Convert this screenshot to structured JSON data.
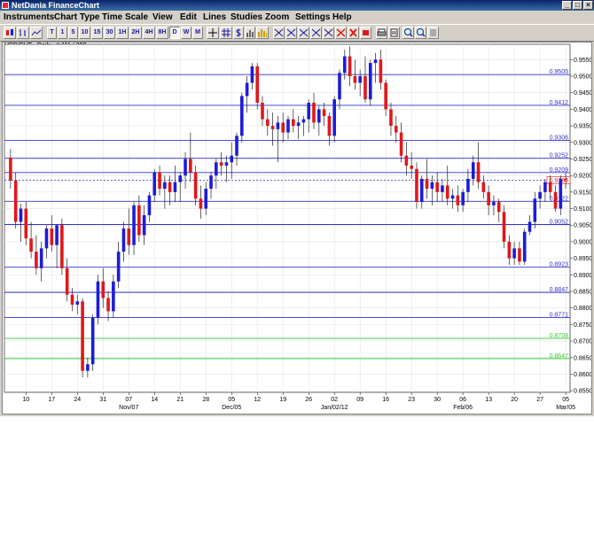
{
  "window": {
    "title": "NetDania FinanceChart",
    "minimize": "_",
    "maximize": "□",
    "close": "×"
  },
  "menu": [
    "Instruments",
    "Chart Type",
    "Time Scale",
    "View",
    "Edit",
    "Lines",
    "Studies",
    "Zoom",
    "Settings",
    "Help"
  ],
  "toolbar": {
    "timeframes": [
      "T",
      "1",
      "5",
      "10",
      "15",
      "30",
      "1H",
      "2H",
      "4H",
      "8H",
      "D",
      "W",
      "M"
    ],
    "selected_timeframe": "D",
    "tool_icons": [
      "candle-icon",
      "bars-icon",
      "line-chart-icon",
      "crosshair-icon",
      "grid-icon",
      "dollar-icon",
      "volume-icon",
      "trendline-icon",
      "channel-icon",
      "fibonacci-icon",
      "fan-icon",
      "arc-icon",
      "delete-line-icon",
      "delete-all-icon",
      "eraser-icon",
      "print-icon",
      "save-icon",
      "zoom-in-icon",
      "zoom-out-icon",
      "reset-icon"
    ]
  },
  "chart_data": {
    "type": "candlestick",
    "instrument_label": "USD/CHF , Daily , # 111 / 300",
    "current_price_label": "0.9186",
    "y_range": [
      0.855,
      0.96
    ],
    "y_ticks": [
      "0.9550",
      "0.9500",
      "0.9450",
      "0.9400",
      "0.9350",
      "0.9300",
      "0.9250",
      "0.9200",
      "0.9150",
      "0.9100",
      "0.9050",
      "0.9000",
      "0.8950",
      "0.8900",
      "0.8850",
      "0.8800",
      "0.8750",
      "0.8700",
      "0.8650",
      "0.8600",
      "0.8550"
    ],
    "x_ticks": [
      "10",
      "17",
      "24",
      "31",
      "07",
      "14",
      "21",
      "28",
      "05",
      "12",
      "19",
      "26",
      "02",
      "09",
      "16",
      "23",
      "30",
      "06",
      "13",
      "20",
      "27",
      "05"
    ],
    "x_month_labels": [
      {
        "label": "Nov/07",
        "index": 4
      },
      {
        "label": "Dec/05",
        "index": 8
      },
      {
        "label": "Jan/02/12",
        "index": 12
      },
      {
        "label": "Feb/06",
        "index": 17
      },
      {
        "label": "Mar/05",
        "index": 21
      }
    ],
    "horizontal_lines": [
      {
        "value": 0.9505,
        "label": "0.9505",
        "color": "#3333cc"
      },
      {
        "value": 0.9412,
        "label": "0.9412",
        "color": "#3333cc"
      },
      {
        "value": 0.9306,
        "label": "0.9306",
        "color": "#3333cc"
      },
      {
        "value": 0.9252,
        "label": "0.9252",
        "color": "#3333cc"
      },
      {
        "value": 0.9209,
        "label": "0.9209",
        "color": "#3333cc"
      },
      {
        "value": 0.9122,
        "label": "0.9122",
        "color": "#3333cc"
      },
      {
        "value": 0.9052,
        "label": "0.9052",
        "color": "#3333cc"
      },
      {
        "value": 0.8923,
        "label": "0.8923",
        "color": "#3333cc"
      },
      {
        "value": 0.8847,
        "label": "0.8847",
        "color": "#3333cc"
      },
      {
        "value": 0.8771,
        "label": "0.8771",
        "color": "#3333cc"
      },
      {
        "value": 0.8708,
        "label": "0.8708",
        "color": "#33cc33"
      },
      {
        "value": 0.8647,
        "label": "0.8647",
        "color": "#33cc33"
      }
    ],
    "current_price": 0.9186,
    "up_color": "#1c1cd8",
    "down_color": "#e01818",
    "grid": true,
    "candles": [
      [
        0.9254,
        0.928,
        0.916,
        0.9185
      ],
      [
        0.9185,
        0.921,
        0.904,
        0.906
      ],
      [
        0.906,
        0.9115,
        0.9,
        0.91
      ],
      [
        0.91,
        0.912,
        0.899,
        0.901
      ],
      [
        0.901,
        0.906,
        0.895,
        0.897
      ],
      [
        0.897,
        0.902,
        0.89,
        0.892
      ],
      [
        0.892,
        0.9,
        0.888,
        0.898
      ],
      [
        0.898,
        0.905,
        0.895,
        0.904
      ],
      [
        0.904,
        0.908,
        0.897,
        0.899
      ],
      [
        0.899,
        0.903,
        0.892,
        0.905
      ],
      [
        0.905,
        0.907,
        0.89,
        0.892
      ],
      [
        0.892,
        0.895,
        0.882,
        0.884
      ],
      [
        0.884,
        0.886,
        0.879,
        0.881
      ],
      [
        0.881,
        0.884,
        0.878,
        0.882
      ],
      [
        0.882,
        0.883,
        0.859,
        0.861
      ],
      [
        0.861,
        0.865,
        0.859,
        0.863
      ],
      [
        0.863,
        0.878,
        0.861,
        0.877
      ],
      [
        0.877,
        0.89,
        0.875,
        0.888
      ],
      [
        0.888,
        0.892,
        0.88,
        0.883
      ],
      [
        0.883,
        0.885,
        0.876,
        0.879
      ],
      [
        0.879,
        0.89,
        0.877,
        0.888
      ],
      [
        0.888,
        0.9,
        0.886,
        0.897
      ],
      [
        0.897,
        0.906,
        0.894,
        0.904
      ],
      [
        0.904,
        0.91,
        0.896,
        0.899
      ],
      [
        0.899,
        0.912,
        0.896,
        0.911
      ],
      [
        0.911,
        0.914,
        0.9,
        0.902
      ],
      [
        0.902,
        0.911,
        0.899,
        0.908
      ],
      [
        0.908,
        0.915,
        0.906,
        0.914
      ],
      [
        0.914,
        0.922,
        0.912,
        0.921
      ],
      [
        0.921,
        0.923,
        0.914,
        0.916
      ],
      [
        0.916,
        0.92,
        0.91,
        0.918
      ],
      [
        0.918,
        0.92,
        0.911,
        0.915
      ],
      [
        0.915,
        0.923,
        0.912,
        0.918
      ],
      [
        0.918,
        0.921,
        0.912,
        0.92
      ],
      [
        0.92,
        0.927,
        0.916,
        0.925
      ],
      [
        0.925,
        0.933,
        0.918,
        0.921
      ],
      [
        0.921,
        0.923,
        0.911,
        0.913
      ],
      [
        0.913,
        0.917,
        0.907,
        0.91
      ],
      [
        0.91,
        0.918,
        0.908,
        0.916
      ],
      [
        0.916,
        0.921,
        0.913,
        0.92
      ],
      [
        0.92,
        0.925,
        0.916,
        0.924
      ],
      [
        0.924,
        0.927,
        0.92,
        0.923
      ],
      [
        0.923,
        0.926,
        0.918,
        0.924
      ],
      [
        0.924,
        0.93,
        0.919,
        0.926
      ],
      [
        0.926,
        0.933,
        0.923,
        0.932
      ],
      [
        0.932,
        0.945,
        0.93,
        0.944
      ],
      [
        0.944,
        0.95,
        0.939,
        0.948
      ],
      [
        0.948,
        0.954,
        0.946,
        0.953
      ],
      [
        0.953,
        0.954,
        0.94,
        0.942
      ],
      [
        0.942,
        0.944,
        0.935,
        0.937
      ],
      [
        0.937,
        0.94,
        0.932,
        0.935
      ],
      [
        0.935,
        0.939,
        0.929,
        0.934
      ],
      [
        0.934,
        0.938,
        0.924,
        0.936
      ],
      [
        0.936,
        0.939,
        0.93,
        0.933
      ],
      [
        0.933,
        0.938,
        0.931,
        0.937
      ],
      [
        0.937,
        0.94,
        0.933,
        0.935
      ],
      [
        0.935,
        0.938,
        0.931,
        0.936
      ],
      [
        0.936,
        0.938,
        0.932,
        0.937
      ],
      [
        0.937,
        0.943,
        0.933,
        0.942
      ],
      [
        0.942,
        0.945,
        0.934,
        0.936
      ],
      [
        0.936,
        0.941,
        0.932,
        0.94
      ],
      [
        0.94,
        0.942,
        0.935,
        0.938
      ],
      [
        0.938,
        0.939,
        0.929,
        0.932
      ],
      [
        0.932,
        0.944,
        0.93,
        0.943
      ],
      [
        0.943,
        0.952,
        0.94,
        0.951
      ],
      [
        0.951,
        0.958,
        0.949,
        0.956
      ],
      [
        0.956,
        0.959,
        0.947,
        0.95
      ],
      [
        0.95,
        0.955,
        0.946,
        0.948
      ],
      [
        0.948,
        0.952,
        0.944,
        0.95
      ],
      [
        0.95,
        0.956,
        0.942,
        0.943
      ],
      [
        0.943,
        0.955,
        0.941,
        0.954
      ],
      [
        0.954,
        0.957,
        0.948,
        0.955
      ],
      [
        0.955,
        0.958,
        0.946,
        0.948
      ],
      [
        0.948,
        0.949,
        0.938,
        0.94
      ],
      [
        0.94,
        0.942,
        0.932,
        0.935
      ],
      [
        0.935,
        0.938,
        0.93,
        0.933
      ],
      [
        0.933,
        0.936,
        0.924,
        0.926
      ],
      [
        0.926,
        0.93,
        0.92,
        0.923
      ],
      [
        0.923,
        0.927,
        0.919,
        0.922
      ],
      [
        0.922,
        0.924,
        0.91,
        0.912
      ],
      [
        0.912,
        0.92,
        0.91,
        0.919
      ],
      [
        0.919,
        0.925,
        0.913,
        0.916
      ],
      [
        0.916,
        0.92,
        0.911,
        0.918
      ],
      [
        0.918,
        0.921,
        0.912,
        0.915
      ],
      [
        0.915,
        0.919,
        0.912,
        0.917
      ],
      [
        0.917,
        0.923,
        0.911,
        0.913
      ],
      [
        0.913,
        0.916,
        0.91,
        0.914
      ],
      [
        0.914,
        0.917,
        0.909,
        0.911
      ],
      [
        0.911,
        0.916,
        0.909,
        0.915
      ],
      [
        0.915,
        0.922,
        0.912,
        0.919
      ],
      [
        0.919,
        0.926,
        0.917,
        0.924
      ],
      [
        0.924,
        0.93,
        0.916,
        0.918
      ],
      [
        0.918,
        0.92,
        0.913,
        0.915
      ],
      [
        0.915,
        0.917,
        0.908,
        0.911
      ],
      [
        0.911,
        0.914,
        0.908,
        0.912
      ],
      [
        0.912,
        0.913,
        0.906,
        0.909
      ],
      [
        0.909,
        0.911,
        0.898,
        0.9
      ],
      [
        0.9,
        0.902,
        0.893,
        0.895
      ],
      [
        0.895,
        0.9,
        0.893,
        0.898
      ],
      [
        0.898,
        0.9,
        0.893,
        0.894
      ],
      [
        0.894,
        0.904,
        0.893,
        0.903
      ],
      [
        0.903,
        0.908,
        0.902,
        0.906
      ],
      [
        0.906,
        0.915,
        0.904,
        0.913
      ],
      [
        0.913,
        0.917,
        0.91,
        0.915
      ],
      [
        0.915,
        0.919,
        0.912,
        0.918
      ],
      [
        0.918,
        0.92,
        0.913,
        0.915
      ],
      [
        0.915,
        0.917,
        0.909,
        0.91
      ],
      [
        0.91,
        0.92,
        0.908,
        0.919
      ],
      [
        0.919,
        0.921,
        0.916,
        0.9186
      ]
    ]
  }
}
